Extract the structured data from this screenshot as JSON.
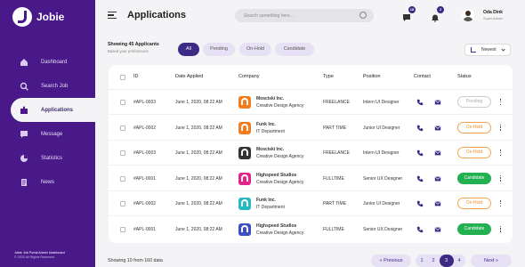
{
  "app": {
    "name": "Jobie"
  },
  "sidebar": {
    "items": [
      {
        "label": "Dashboard"
      },
      {
        "label": "Search Job"
      },
      {
        "label": "Applications"
      },
      {
        "label": "Message"
      },
      {
        "label": "Statistics"
      },
      {
        "label": "News"
      }
    ],
    "footer_title": "Jobie Job Portal Admin Dashboard",
    "footer_copy": "© 2020 All Rights Reserved"
  },
  "header": {
    "title": "Applications",
    "search_placeholder": "Search something here...",
    "messages_count": "18",
    "notifications_count": "2",
    "user_name": "Oda Dink",
    "user_role": "Super Admin"
  },
  "filters": {
    "count_text": "Showing 45 Applicants",
    "sub_text": "Based your preferences",
    "chips": [
      "All",
      "Pending",
      "On-Hold",
      "Candidate"
    ],
    "sort_label": "Newest"
  },
  "table": {
    "columns": [
      "ID",
      "Date Applied",
      "Company",
      "Type",
      "Position",
      "Contact",
      "Status"
    ],
    "rows": [
      {
        "id": "#APL-0003",
        "date": "June 1, 2020, 08:22 AM",
        "company": "Mosciski Inc.",
        "company_sub": "Creative Design Agency",
        "type": "FREELANCE",
        "position": "Intern UI Designer",
        "status": "Pending",
        "logo_color": "#f27c1e",
        "contact_color": "#3d2a85"
      },
      {
        "id": "#APL-0002",
        "date": "June 1, 2020, 08:22 AM",
        "company": "Funk Inc.",
        "company_sub": "IT Department",
        "type": "PART TIME",
        "position": "Junior UI Designer",
        "status": "On-Hold",
        "logo_color": "#f27c1e",
        "contact_color": "#3d2a85"
      },
      {
        "id": "#APL-0003",
        "date": "June 1, 2020, 08:22 AM",
        "company": "Mosciski Inc.",
        "company_sub": "Creative Design Agency",
        "type": "FREELANCE",
        "position": "Intern UI Designer",
        "status": "On-Hold",
        "logo_color": "#333333",
        "contact_color": "#3d2a85"
      },
      {
        "id": "#APL-0001",
        "date": "June 1, 2020, 08:22 AM",
        "company": "Highspeed Studios",
        "company_sub": "Creative Design Agency",
        "type": "FULLTIME",
        "position": "Senior UX Designer",
        "status": "Candidate",
        "logo_color": "#e3248b",
        "contact_color": "#3d2a85"
      },
      {
        "id": "#APL-0002",
        "date": "June 1, 2020, 08:22 AM",
        "company": "Funk Inc.",
        "company_sub": "IT Department",
        "type": "PART TIME",
        "position": "Junior UI Designer",
        "status": "On-Hold",
        "logo_color": "#25b9c4",
        "contact_color": "#3d2a85"
      },
      {
        "id": "#APL-0001",
        "date": "June 1, 2020, 08:22 AM",
        "company": "Highspeed Studios",
        "company_sub": "Creative Design Agency",
        "type": "FULLTIME",
        "position": "Senior UX Designer",
        "status": "Candidate",
        "logo_color": "#3d4fc4",
        "contact_color": "#3d2a85"
      }
    ]
  },
  "pagination": {
    "info": "Showing 10 from 160 data",
    "prev_label": "« Previous",
    "next_label": "Next »",
    "pages": [
      "1",
      "2",
      "3",
      "4"
    ],
    "current_page": "3"
  }
}
